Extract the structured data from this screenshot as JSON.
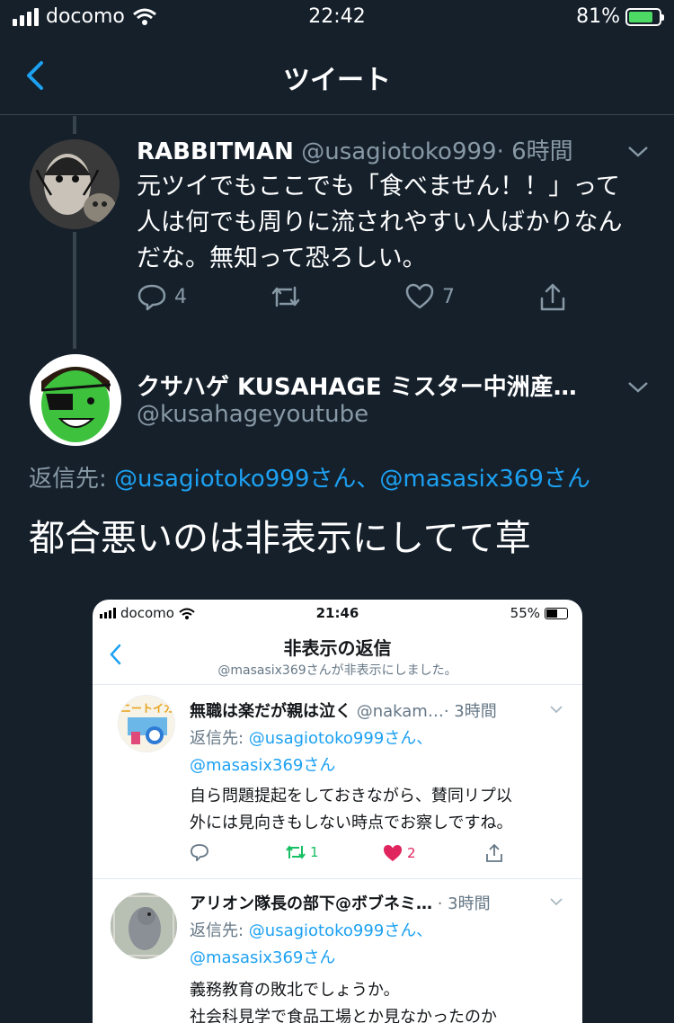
{
  "status_bar": {
    "carrier": "docomo",
    "time": "22:42",
    "battery": "81%",
    "battery_level": 0.81
  },
  "nav": {
    "title": "ツイート"
  },
  "tweet1": {
    "name": "RABBITMAN",
    "handle": "@usagiotoko999",
    "time": "· 6時間",
    "text_lines": [
      "元ツイでもここでも「食べません！！」って",
      "人は何でも周りに流されやすい人ばかりなん",
      "だな。無知って恐ろしい。"
    ],
    "replies": "4",
    "likes": "7"
  },
  "tweet2": {
    "name": "クサハゲ KUSAHAGE ミスター中洲産…",
    "handle": "@kusahageyoutube",
    "replying_label": "返信先: ",
    "replying_to": "@usagiotoko999さん、@masasix369さん",
    "text": "都合悪いのは非表示にしてて草"
  },
  "screenshot": {
    "carrier": "docomo",
    "time": "21:46",
    "battery": "55%",
    "battery_level": 0.55,
    "title": "非表示の返信",
    "subtitle": "@masasix369さんが非表示にしました。",
    "reply1": {
      "name": "無職は楽だが親は泣く",
      "handle": "@nakam…",
      "time": "· 3時間",
      "replying_label": "返信先: ",
      "replying_to_1": "@usagiotoko999さん、",
      "replying_to_2": "@masasix369さん",
      "text_lines": [
        "自ら問題提起をしておきながら、賛同リプ以",
        "外には見向きもしない時点でお察しですね。"
      ],
      "retweets": "1",
      "likes": "2",
      "avatar_text": "ニートイカ"
    },
    "reply2": {
      "name": "アリオン隊長の部下@ボブネミ…",
      "time": "· 3時間",
      "replying_label": "返信先: ",
      "replying_to_1": "@usagiotoko999さん、",
      "replying_to_2": "@masasix369さん",
      "text_lines": [
        "義務教育の敗北でしょうか。",
        "社会科見学で食品工場とか見なかったのか"
      ]
    }
  },
  "colors": {
    "background": "#15202b",
    "accent": "#1da1f2",
    "muted": "#8899a6",
    "retweet": "#17bf63",
    "like": "#e0245e"
  }
}
